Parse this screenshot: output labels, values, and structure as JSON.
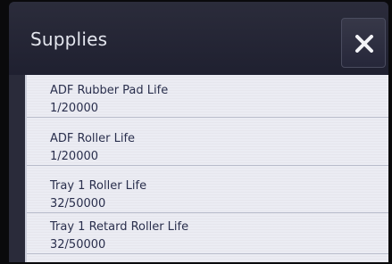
{
  "header": {
    "title": "Supplies",
    "close_icon": "close-icon"
  },
  "supplies": [
    {
      "name": "ADF Rubber Pad Life",
      "value": "1/20000"
    },
    {
      "name": "ADF Roller Life",
      "value": "1/20000"
    },
    {
      "name": "Tray 1 Roller Life",
      "value": "32/50000"
    },
    {
      "name": "Tray 1 Retard Roller Life",
      "value": "32/50000"
    }
  ]
}
